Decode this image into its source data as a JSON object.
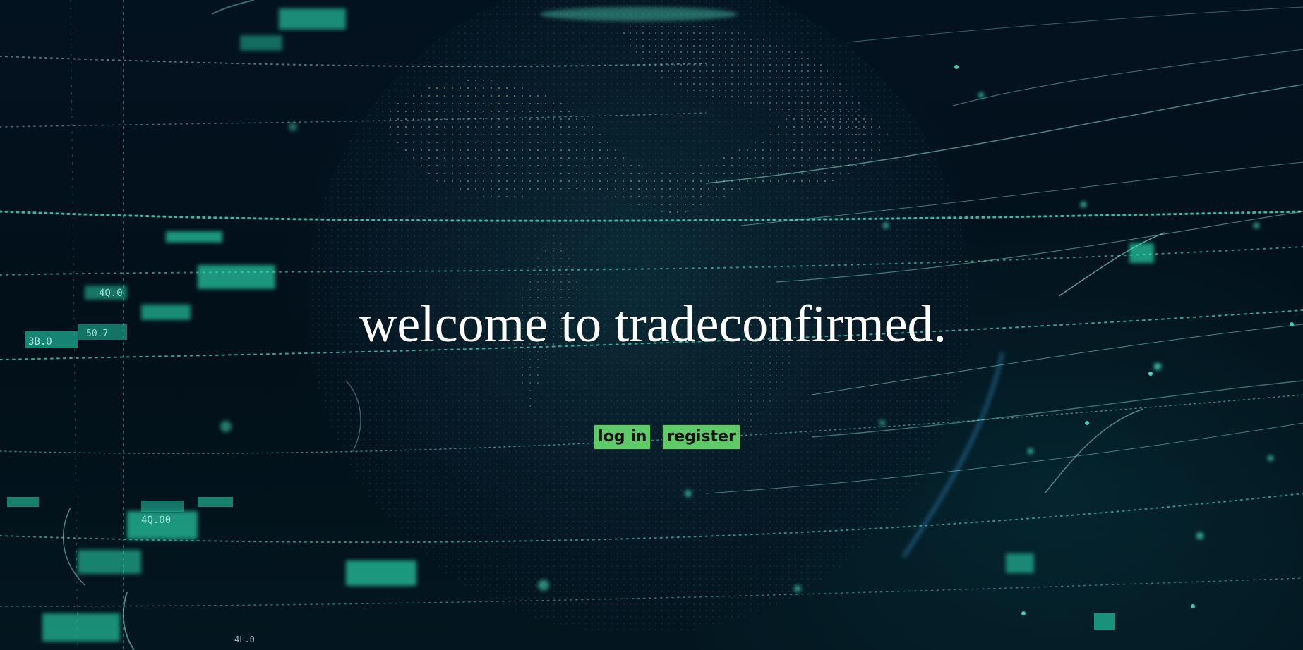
{
  "hero": {
    "title": "welcome to tradeconfirmed."
  },
  "actions": {
    "login_label": "log in",
    "register_label": "register"
  },
  "colors": {
    "button_bg": "#5fcb68",
    "title_text": "#ffffff",
    "background": "#02101c",
    "accent_glow": "#2ef0c0"
  },
  "background": {
    "panel_labels": [
      "3B.0",
      "50.7",
      "4Q.00",
      "4Q.0",
      "4L.0"
    ]
  }
}
